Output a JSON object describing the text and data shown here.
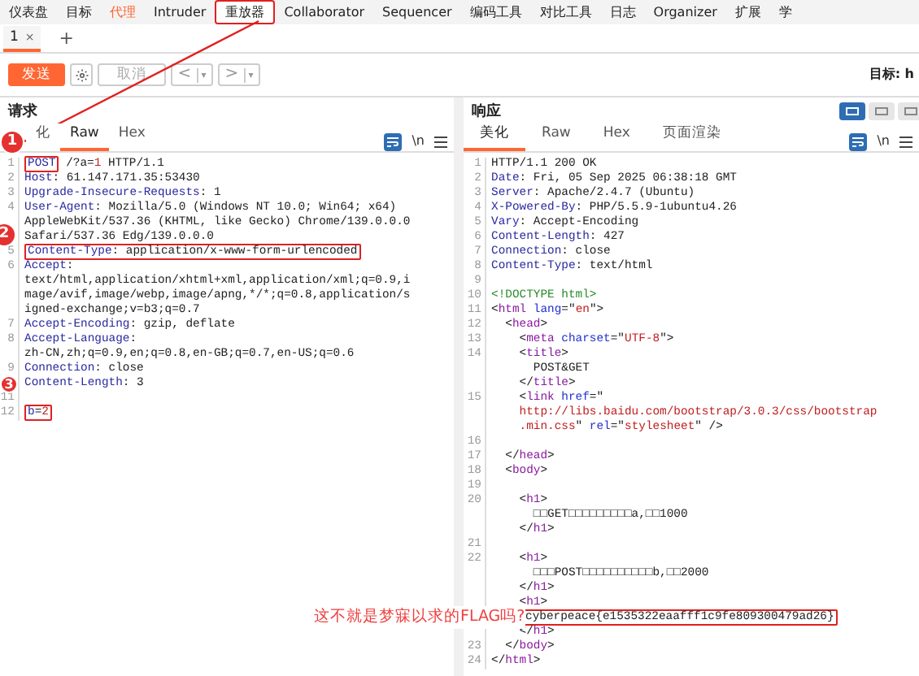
{
  "nav_tabs": [
    {
      "label": "仪表盘",
      "selected": false,
      "highlighted": false
    },
    {
      "label": "目标",
      "selected": false,
      "highlighted": false
    },
    {
      "label": "代理",
      "selected": false,
      "highlighted": true
    },
    {
      "label": "Intruder",
      "selected": false,
      "highlighted": false
    },
    {
      "label": "重放器",
      "selected": true,
      "highlighted": false
    },
    {
      "label": "Collaborator",
      "selected": false,
      "highlighted": false
    },
    {
      "label": "Sequencer",
      "selected": false,
      "highlighted": false
    },
    {
      "label": "编码工具",
      "selected": false,
      "highlighted": false
    },
    {
      "label": "对比工具",
      "selected": false,
      "highlighted": false
    },
    {
      "label": "日志",
      "selected": false,
      "highlighted": false
    },
    {
      "label": "Organizer",
      "selected": false,
      "highlighted": false
    },
    {
      "label": "扩展",
      "selected": false,
      "highlighted": false
    },
    {
      "label": "学",
      "selected": false,
      "highlighted": false
    }
  ],
  "repeater_tabs": [
    {
      "label": "1",
      "close": "×",
      "selected": true
    }
  ],
  "add_tab": "+",
  "toolbar": {
    "send": "发送",
    "cancel": "取消",
    "cancel_disabled": true,
    "prev": "<",
    "next": ">",
    "dropdown": "▾",
    "target": "目标: h"
  },
  "request": {
    "title": "请求",
    "tabs": [
      {
        "label": "化",
        "selected": false
      },
      {
        "label": "Raw",
        "selected": true
      },
      {
        "label": "Hex",
        "selected": false
      }
    ],
    "newline": "\\n",
    "lines": [
      {
        "number": "1",
        "segments": [
          {
            "kind": "box",
            "segments": [
              {
                "kind": "key",
                "text": "POST"
              }
            ]
          },
          {
            "kind": "plain",
            "text": " /?a="
          },
          {
            "kind": "str",
            "text": "1"
          },
          {
            "kind": "plain",
            "text": " HTTP/1.1"
          }
        ]
      },
      {
        "number": "2",
        "segments": [
          {
            "kind": "key",
            "text": "Host"
          },
          {
            "kind": "plain",
            "text": ": 61.147.171.35:53430"
          }
        ]
      },
      {
        "number": "3",
        "segments": [
          {
            "kind": "key",
            "text": "Upgrade-Insecure-Requests"
          },
          {
            "kind": "plain",
            "text": ": 1"
          }
        ]
      },
      {
        "number": "4",
        "segments": [
          {
            "kind": "key",
            "text": "User-Agent"
          },
          {
            "kind": "plain",
            "text": ": Mozilla/5.0 (Windows NT 10.0; Win64; x64)"
          }
        ]
      },
      {
        "segments": [
          {
            "kind": "plain",
            "text": "AppleWebKit/537.36 (KHTML, like Gecko) Chrome/139.0.0.0"
          }
        ]
      },
      {
        "segments": [
          {
            "kind": "plain",
            "text": "Safari/537.36 Edg/139.0.0.0"
          }
        ]
      },
      {
        "number": "5",
        "segments": [
          {
            "kind": "box",
            "segments": [
              {
                "kind": "key",
                "text": "Content-Type"
              },
              {
                "kind": "plain",
                "text": ": application/x-www-form-urlencoded"
              }
            ]
          }
        ]
      },
      {
        "number": "6",
        "segments": [
          {
            "kind": "key",
            "text": "Accept"
          },
          {
            "kind": "plain",
            "text": ":"
          }
        ]
      },
      {
        "segments": [
          {
            "kind": "plain",
            "text": "text/html,application/xhtml+xml,application/xml;q=0.9,i"
          }
        ]
      },
      {
        "segments": [
          {
            "kind": "plain",
            "text": "mage/avif,image/webp,image/apng,*/*;q=0.8,application/s"
          }
        ]
      },
      {
        "segments": [
          {
            "kind": "plain",
            "text": "igned-exchange;v=b3;q=0.7"
          }
        ]
      },
      {
        "number": "7",
        "segments": [
          {
            "kind": "key",
            "text": "Accept-Encoding"
          },
          {
            "kind": "plain",
            "text": ": gzip, deflate"
          }
        ]
      },
      {
        "number": "8",
        "segments": [
          {
            "kind": "key",
            "text": "Accept-Language"
          },
          {
            "kind": "plain",
            "text": ":"
          }
        ]
      },
      {
        "segments": [
          {
            "kind": "plain",
            "text": "zh-CN,zh;q=0.9,en;q=0.8,en-GB;q=0.7,en-US;q=0.6"
          }
        ]
      },
      {
        "number": "9",
        "segments": [
          {
            "kind": "key",
            "text": "Connection"
          },
          {
            "kind": "plain",
            "text": ": close"
          }
        ]
      },
      {
        "segments": [
          {
            "kind": "key",
            "text": "Content-Length"
          },
          {
            "kind": "plain",
            "text": ": 3"
          }
        ]
      },
      {
        "number": "11"
      },
      {
        "number": "12",
        "segments": [
          {
            "kind": "box",
            "segments": [
              {
                "kind": "key",
                "text": "b"
              },
              {
                "kind": "plain",
                "text": "="
              },
              {
                "kind": "str",
                "text": "2"
              }
            ]
          }
        ]
      }
    ]
  },
  "response": {
    "title": "响应",
    "views": [
      {
        "selected": true
      },
      {
        "selected": false
      },
      {
        "selected": false
      }
    ],
    "tabs": [
      {
        "label": "美化",
        "selected": true
      },
      {
        "label": "Raw",
        "selected": false
      },
      {
        "label": "Hex",
        "selected": false
      },
      {
        "label": "页面渲染",
        "selected": false
      }
    ],
    "newline": "\\n",
    "lines": [
      {
        "number": "1",
        "segments": [
          {
            "kind": "plain",
            "text": "HTTP/1.1 200 OK"
          }
        ]
      },
      {
        "number": "2",
        "segments": [
          {
            "kind": "key",
            "text": "Date"
          },
          {
            "kind": "plain",
            "text": ": Fri, 05 Sep 2025 06:38:18 GMT"
          }
        ]
      },
      {
        "number": "3",
        "segments": [
          {
            "kind": "key",
            "text": "Server"
          },
          {
            "kind": "plain",
            "text": ": Apache/2.4.7 (Ubuntu)"
          }
        ]
      },
      {
        "number": "4",
        "segments": [
          {
            "kind": "key",
            "text": "X-Powered-By"
          },
          {
            "kind": "plain",
            "text": ": PHP/5.5.9-1ubuntu4.26"
          }
        ]
      },
      {
        "number": "5",
        "segments": [
          {
            "kind": "key",
            "text": "Vary"
          },
          {
            "kind": "plain",
            "text": ": Accept-Encoding"
          }
        ]
      },
      {
        "number": "6",
        "segments": [
          {
            "kind": "key",
            "text": "Content-Length"
          },
          {
            "kind": "plain",
            "text": ": 427"
          }
        ]
      },
      {
        "number": "7",
        "segments": [
          {
            "kind": "key",
            "text": "Connection"
          },
          {
            "kind": "plain",
            "text": ": close"
          }
        ]
      },
      {
        "number": "8",
        "segments": [
          {
            "kind": "key",
            "text": "Content-Type"
          },
          {
            "kind": "plain",
            "text": ": text/html"
          }
        ]
      },
      {
        "number": "9"
      },
      {
        "number": "10",
        "segments": [
          {
            "kind": "doctype",
            "text": "<!DOCTYPE html>"
          }
        ]
      },
      {
        "number": "11",
        "segments": [
          {
            "kind": "plain",
            "text": "<"
          },
          {
            "kind": "tag",
            "text": "html"
          },
          {
            "kind": "attr",
            "text": " lang"
          },
          {
            "kind": "plain",
            "text": "=\""
          },
          {
            "kind": "str",
            "text": "en"
          },
          {
            "kind": "plain",
            "text": "\">"
          }
        ]
      },
      {
        "number": "12",
        "segments": [
          {
            "kind": "plain",
            "text": "  <"
          },
          {
            "kind": "tag",
            "text": "head"
          },
          {
            "kind": "plain",
            "text": ">"
          }
        ]
      },
      {
        "number": "13",
        "segments": [
          {
            "kind": "plain",
            "text": "    <"
          },
          {
            "kind": "tag",
            "text": "meta"
          },
          {
            "kind": "attr",
            "text": " charset"
          },
          {
            "kind": "plain",
            "text": "=\""
          },
          {
            "kind": "str",
            "text": "UTF-8"
          },
          {
            "kind": "plain",
            "text": "\">"
          }
        ]
      },
      {
        "number": "14",
        "segments": [
          {
            "kind": "plain",
            "text": "    <"
          },
          {
            "kind": "tag",
            "text": "title"
          },
          {
            "kind": "plain",
            "text": ">"
          }
        ]
      },
      {
        "segments": [
          {
            "kind": "plain",
            "text": "      POST&GET"
          }
        ]
      },
      {
        "segments": [
          {
            "kind": "plain",
            "text": "    </"
          },
          {
            "kind": "tag",
            "text": "title"
          },
          {
            "kind": "plain",
            "text": ">"
          }
        ]
      },
      {
        "number": "15",
        "segments": [
          {
            "kind": "plain",
            "text": "    <"
          },
          {
            "kind": "tag",
            "text": "link"
          },
          {
            "kind": "attr",
            "text": " href"
          },
          {
            "kind": "plain",
            "text": "=\""
          }
        ]
      },
      {
        "segments": [
          {
            "kind": "str",
            "text": "    http://libs.baidu.com/bootstrap/3.0.3/css/bootstrap"
          }
        ]
      },
      {
        "segments": [
          {
            "kind": "str",
            "text": "    .min.css"
          },
          {
            "kind": "plain",
            "text": "\" "
          },
          {
            "kind": "attr",
            "text": "rel"
          },
          {
            "kind": "plain",
            "text": "=\""
          },
          {
            "kind": "str",
            "text": "stylesheet"
          },
          {
            "kind": "plain",
            "text": "\" />"
          }
        ]
      },
      {
        "number": "16"
      },
      {
        "number": "17",
        "segments": [
          {
            "kind": "plain",
            "text": "  </"
          },
          {
            "kind": "tag",
            "text": "head"
          },
          {
            "kind": "plain",
            "text": ">"
          }
        ]
      },
      {
        "number": "18",
        "segments": [
          {
            "kind": "plain",
            "text": "  <"
          },
          {
            "kind": "tag",
            "text": "body"
          },
          {
            "kind": "plain",
            "text": ">"
          }
        ]
      },
      {
        "number": "19"
      },
      {
        "number": "20",
        "segments": [
          {
            "kind": "plain",
            "text": "    <"
          },
          {
            "kind": "tag",
            "text": "h1"
          },
          {
            "kind": "plain",
            "text": ">"
          }
        ]
      },
      {
        "segments": [
          {
            "kind": "plain",
            "text": "      □□GET□□□□□□□□□a,□□1000"
          }
        ]
      },
      {
        "segments": [
          {
            "kind": "plain",
            "text": "    </"
          },
          {
            "kind": "tag",
            "text": "h1"
          },
          {
            "kind": "plain",
            "text": ">"
          }
        ]
      },
      {
        "number": "21"
      },
      {
        "number": "22",
        "segments": [
          {
            "kind": "plain",
            "text": "    <"
          },
          {
            "kind": "tag",
            "text": "h1"
          },
          {
            "kind": "plain",
            "text": ">"
          }
        ]
      },
      {
        "segments": [
          {
            "kind": "plain",
            "text": "      □□□POST□□□□□□□□□□b,□□2000"
          }
        ]
      },
      {
        "segments": [
          {
            "kind": "plain",
            "text": "    </"
          },
          {
            "kind": "tag",
            "text": "h1"
          },
          {
            "kind": "plain",
            "text": ">"
          }
        ]
      },
      {
        "segments": [
          {
            "kind": "plain",
            "text": "    <"
          },
          {
            "kind": "tag",
            "text": "h1"
          },
          {
            "kind": "plain",
            "text": ">"
          }
        ]
      },
      {
        "segments": [
          {
            "kind": "box",
            "segments": [
              {
                "kind": "plain",
                "text": "cyberpeace{e1535322eaafff1c9fe809300479ad26}"
              }
            ]
          }
        ]
      },
      {
        "segments": [
          {
            "kind": "plain",
            "text": "    </"
          },
          {
            "kind": "tag",
            "text": "h1"
          },
          {
            "kind": "plain",
            "text": ">"
          }
        ]
      },
      {
        "number": "23",
        "segments": [
          {
            "kind": "plain",
            "text": "  </"
          },
          {
            "kind": "tag",
            "text": "body"
          },
          {
            "kind": "plain",
            "text": ">"
          }
        ]
      },
      {
        "number": "24",
        "segments": [
          {
            "kind": "plain",
            "text": "</"
          },
          {
            "kind": "tag",
            "text": "html"
          },
          {
            "kind": "plain",
            "text": ">"
          }
        ]
      }
    ]
  },
  "annotations": {
    "markers": [
      "1",
      "2",
      "3"
    ],
    "note": "这不就是梦寐以求的FLAG吗?"
  }
}
